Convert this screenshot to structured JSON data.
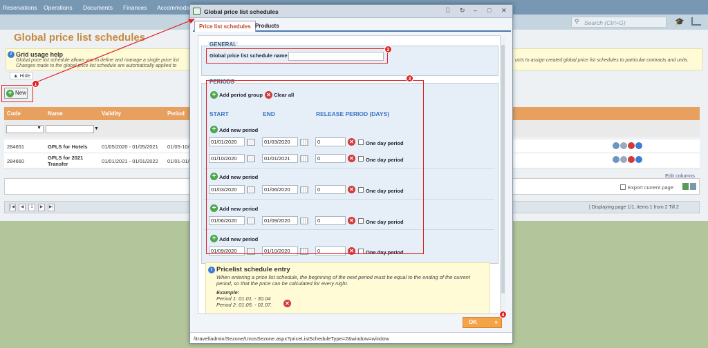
{
  "topnav": [
    "Reservations",
    "Operations",
    "Documents",
    "Finances",
    "Accommodat"
  ],
  "search": {
    "placeholder": "Search (Ctrl+G)"
  },
  "page": {
    "title": "Global price list schedules",
    "help_title": "Grid usage help",
    "help_line1": "Global price list schedule allows you to define and manage a single price list",
    "help_line2": "Changes made to the global price list schedule are automatically applied to",
    "help_right": "ucts to assign created global price list schedules to particular contracts and units.",
    "hide_label": "Hide",
    "new_label": "New"
  },
  "grid": {
    "columns": [
      "Code",
      "Name",
      "Validity",
      "Period"
    ],
    "rows": [
      {
        "code": "284651",
        "name": "GPLS for Hotels",
        "validity": "01/05/2020 - 01/05/2021",
        "period": "01/05-10/"
      },
      {
        "code": "284660",
        "name": "GPLS for 2021 Transfer",
        "validity": "01/01/2021 - 01/01/2022",
        "period": "01/01-01/"
      }
    ],
    "edit_columns": "Edit columns",
    "export_label": "Export current page",
    "pager_info": "| Displaying page 1/1, items 1 from 2 Till 2",
    "page_number": "1"
  },
  "dialog": {
    "title": "Global price list schedules",
    "tabs": [
      "Price list schedules",
      "Products"
    ],
    "general_legend": "GENERAL",
    "name_label": "Global price list schedule name",
    "name_value": "",
    "periods_legend": "PERIODS",
    "add_group": "Add period group",
    "clear_all": "Clear all",
    "col_start": "START",
    "col_end": "END",
    "col_release": "RELEASE PERIOD (DAYS)",
    "add_period": "Add new period",
    "one_day": "One day period",
    "periods": [
      {
        "start": "01/01/2020",
        "end": "01/03/2020",
        "release": "0"
      },
      {
        "start": "01/10/2020",
        "end": "01/01/2021",
        "release": "0"
      },
      {
        "start": "01/03/2020",
        "end": "01/06/2020",
        "release": "0"
      },
      {
        "start": "01/06/2020",
        "end": "01/09/2020",
        "release": "0"
      },
      {
        "start": "01/09/2020",
        "end": "01/10/2020",
        "release": "0"
      }
    ],
    "info_title": "Pricelist schedule entry",
    "info_line1": "When entering a price list schedule, the beginning of the next period must be equal to the ending of the current",
    "info_line2": "period, so that the price can be calculated for every night.",
    "example_label": "Example:",
    "example_1": "Period 1: 01.01. - 30.04",
    "example_2": "Period 2: 01.05. - 01.07.",
    "ok_label": "OK",
    "status_url": "/itravel/admin/Sezone/UnosSezone.aspx?priceListScheduleType=2&window=window"
  },
  "badges": [
    "1",
    "2",
    "3",
    "4"
  ],
  "colors": {
    "accent": "#e8a05e",
    "annotation": "#e02020",
    "header": "#7797b3"
  }
}
